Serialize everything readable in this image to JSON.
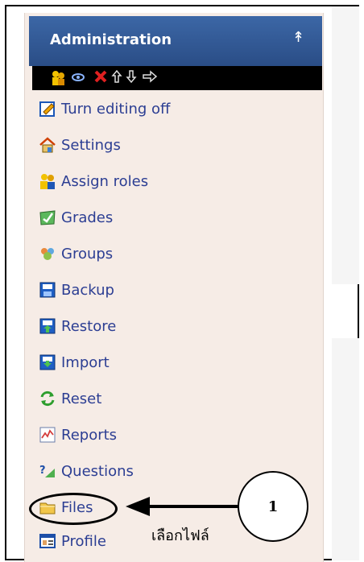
{
  "block": {
    "title": "Administration",
    "collapse_icon": "collapse-up-icon"
  },
  "commands": {
    "icons": [
      "assign-roles-icon",
      "hide-icon",
      "delete-icon",
      "move-up-icon",
      "move-down-icon",
      "move-right-icon"
    ]
  },
  "menu": {
    "items": [
      {
        "label": "Turn editing off",
        "icon": "edit-icon"
      },
      {
        "label": "Settings",
        "icon": "settings-icon"
      },
      {
        "label": "Assign roles",
        "icon": "roles-icon"
      },
      {
        "label": "Grades",
        "icon": "grades-icon"
      },
      {
        "label": "Groups",
        "icon": "groups-icon"
      },
      {
        "label": "Backup",
        "icon": "backup-icon"
      },
      {
        "label": "Restore",
        "icon": "restore-icon"
      },
      {
        "label": "Import",
        "icon": "import-icon"
      },
      {
        "label": "Reset",
        "icon": "reset-icon"
      },
      {
        "label": "Reports",
        "icon": "reports-icon"
      },
      {
        "label": "Questions",
        "icon": "questions-icon"
      },
      {
        "label": "Files",
        "icon": "folder-icon"
      },
      {
        "label": "Profile",
        "icon": "profile-icon"
      }
    ]
  },
  "callout": {
    "number": "1",
    "text": "เลือกไฟล์"
  },
  "colors": {
    "header": "#2a4d86",
    "link": "#2c3e93",
    "block_bg": "#f6ece6"
  }
}
